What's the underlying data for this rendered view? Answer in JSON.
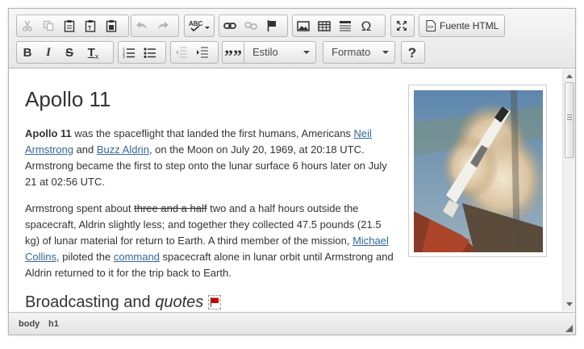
{
  "toolbar": {
    "source_label": "Fuente HTML",
    "style_combo": "Estilo",
    "format_combo": "Formato",
    "help_label": "?",
    "bold_label": "B",
    "italic_label": "I",
    "strike_label": "S",
    "clear_format_label": "T",
    "clear_format_sub": "x",
    "omega_label": "Ω",
    "quote_label": "””"
  },
  "content": {
    "title": "Apollo 11",
    "p1": {
      "bold": "Apollo 11",
      "t1": " was the spaceflight that landed the first humans, Americans ",
      "link1": "Neil Armstrong",
      "t2": " and ",
      "link2": "Buzz Aldrin",
      "t3": ", on the Moon on July 20, 1969, at 20:18 UTC. Armstrong became the first to step onto the lunar surface 6 hours later on July 21 at 02:56 UTC."
    },
    "p2": {
      "t1": "Armstrong spent about ",
      "strike": "three and a half",
      "t2": " two and a half hours outside the spacecraft, Aldrin slightly less; and together they collected 47.5 pounds (21.5 kg) of lunar material for return to Earth. A third member of the mission, ",
      "link1": "Michael Collins",
      "t3": ", piloted the ",
      "link2": "command",
      "t4": " spacecraft alone in lunar orbit until Armstrong and Aldrin returned to it for the trip back to Earth."
    },
    "h2": {
      "text": "Broadcasting and ",
      "italic": "quotes"
    }
  },
  "statusbar": {
    "crumb1": "body",
    "crumb2": "h1"
  },
  "colors": {
    "link": "#336699",
    "flag": "#cc0000"
  }
}
